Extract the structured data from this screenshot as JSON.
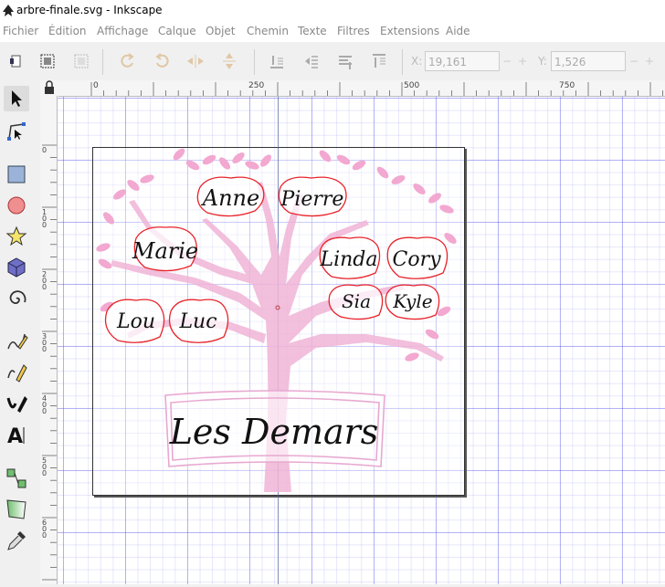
{
  "window": {
    "title": "arbre-finale.svg - Inkscape"
  },
  "menu": {
    "items": [
      "Fichier",
      "Édition",
      "Affichage",
      "Calque",
      "Objet",
      "Chemin",
      "Texte",
      "Filtres",
      "Extensions",
      "Aide"
    ]
  },
  "commands": {
    "x_label": "X:",
    "x_value": "19,161",
    "y_label": "Y:",
    "y_value": "1,526",
    "stepper_minus": "−",
    "stepper_plus": "+"
  },
  "rulers": {
    "top_ticks": [
      "0",
      "250",
      "500",
      "750"
    ],
    "left_ticks": [
      "0",
      "100",
      "200",
      "300",
      "400",
      "500",
      "600"
    ]
  },
  "tools": [
    "selector-tool",
    "node-tool",
    "rectangle-tool",
    "circle-tool",
    "star-tool",
    "3d-box-tool",
    "spiral-tool",
    "pencil-tool",
    "pen-tool",
    "calligraphy-tool",
    "text-tool",
    "connector-tool",
    "gradient-tool",
    "dropper-tool"
  ],
  "drawing": {
    "family_title": "Les Demars",
    "names": [
      "Anne",
      "Pierre",
      "Marie",
      "Linda",
      "Cory",
      "Lou",
      "Luc",
      "Sia",
      "Kyle"
    ]
  },
  "colors": {
    "tree": "#f0b4d6",
    "leaves": "#f2a8d0",
    "outline_red": "#e8232a",
    "grid": "#6464e6",
    "banner": "#e8a8d0"
  }
}
